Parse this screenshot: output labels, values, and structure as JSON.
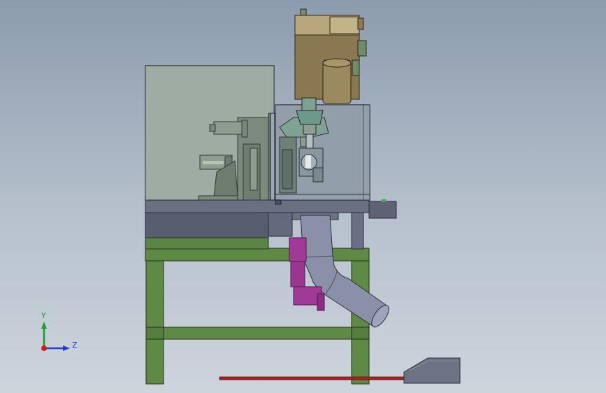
{
  "triad": {
    "y_label": "Y",
    "z_label": "Z",
    "colors": {
      "y": "#1a9a3a",
      "z": "#1f3fd0",
      "x": "#d02020"
    }
  },
  "palette": {
    "viewport_top": "#8b9bad",
    "viewport_bottom": "#cdd4dc",
    "frame": "#5f8a46",
    "bed": "#5d6374",
    "guard": "#9aa9a0",
    "motor": "#8c7a55",
    "magenta": "#a03a96",
    "pipe": "#8a90a8",
    "rail": "#b0201c"
  }
}
